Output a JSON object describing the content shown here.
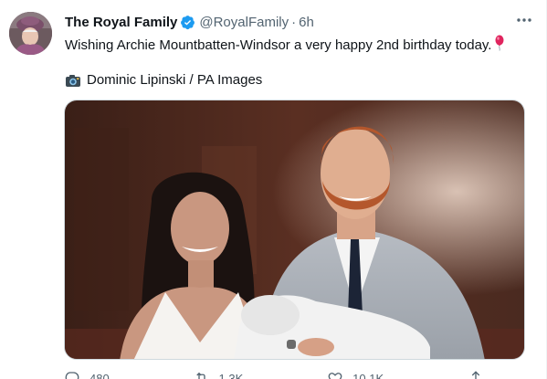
{
  "tweet": {
    "display_name": "The Royal Family",
    "handle": "@RoyalFamily",
    "separator": "·",
    "time": "6h",
    "text": "Wishing Archie Mountbatten-Windsor a very happy 2nd birthday today.",
    "photo_credit": "Dominic Lipinski / PA Images",
    "icons": {
      "avatar": "avatar-queen",
      "verified": "verified-badge-icon",
      "more": "more-options-icon",
      "balloon": "balloon-emoji-icon",
      "camera": "camera-emoji-icon"
    }
  },
  "actions": [
    {
      "name": "reply",
      "icon": "reply-icon",
      "count": "480"
    },
    {
      "name": "retweet",
      "icon": "retweet-icon",
      "count": "1.3K"
    },
    {
      "name": "like",
      "icon": "like-icon",
      "count": "10.1K"
    },
    {
      "name": "share",
      "icon": "share-icon",
      "count": ""
    }
  ],
  "colors": {
    "verified_blue": "#1d9bf0",
    "text_primary": "#0f1419",
    "text_secondary": "#536471"
  }
}
